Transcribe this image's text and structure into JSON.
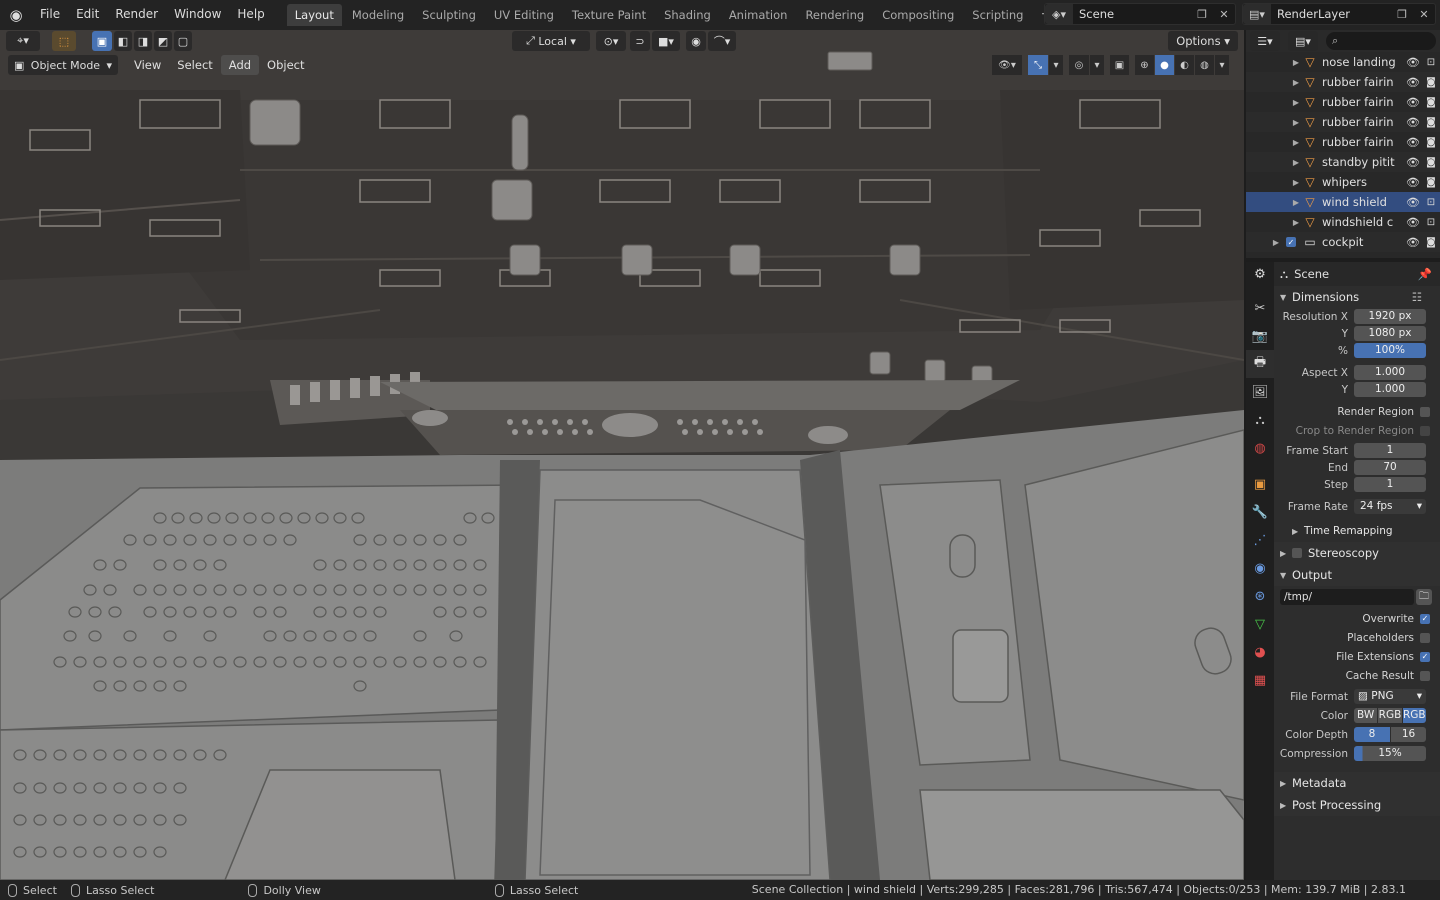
{
  "top_menu": [
    "File",
    "Edit",
    "Render",
    "Window",
    "Help"
  ],
  "workspaces": [
    "Layout",
    "Modeling",
    "Sculpting",
    "UV Editing",
    "Texture Paint",
    "Shading",
    "Animation",
    "Rendering",
    "Compositing",
    "Scripting"
  ],
  "active_workspace": "Layout",
  "scene_name": "Scene",
  "view_layer": "RenderLayer",
  "viewport": {
    "transform_orientation": "Local",
    "options_label": "Options",
    "mode": "Object Mode",
    "menus": [
      "View",
      "Select",
      "Add",
      "Object"
    ]
  },
  "outliner": {
    "rows": [
      {
        "label": "nose landing",
        "selected": false,
        "active_cam": false
      },
      {
        "label": "rubber fairin",
        "selected": false,
        "active_cam": true
      },
      {
        "label": "rubber fairin",
        "selected": false,
        "active_cam": true
      },
      {
        "label": "rubber fairin",
        "selected": false,
        "active_cam": true
      },
      {
        "label": "rubber fairin",
        "selected": false,
        "active_cam": true
      },
      {
        "label": "standby pitit",
        "selected": false,
        "active_cam": true
      },
      {
        "label": "whipers",
        "selected": false,
        "active_cam": true
      },
      {
        "label": "wind shield",
        "selected": true,
        "active_cam": false
      },
      {
        "label": "windshield c",
        "selected": false,
        "active_cam": false
      },
      {
        "label": "cockpit",
        "selected": false,
        "active_cam": true
      }
    ]
  },
  "properties": {
    "context": "Scene",
    "dimensions": {
      "title": "Dimensions",
      "resolution_x_label": "Resolution X",
      "resolution_x": "1920 px",
      "y_label": "Y",
      "resolution_y": "1080 px",
      "percent_label": "%",
      "percent": "100%",
      "aspect_x_label": "Aspect X",
      "aspect_x": "1.000",
      "aspect_y": "1.000",
      "render_region": "Render Region",
      "crop_region": "Crop to Render Region",
      "frame_start_label": "Frame Start",
      "frame_start": "1",
      "end_label": "End",
      "frame_end": "70",
      "step_label": "Step",
      "frame_step": "1",
      "frame_rate_label": "Frame Rate",
      "frame_rate": "24 fps",
      "time_remapping": "Time Remapping"
    },
    "stereoscopy": "Stereoscopy",
    "output": {
      "title": "Output",
      "path": "/tmp/",
      "overwrite": "Overwrite",
      "placeholders": "Placeholders",
      "file_extensions": "File Extensions",
      "cache_result": "Cache Result",
      "file_format_label": "File Format",
      "file_format": "PNG",
      "color_label": "Color",
      "color_options": [
        "BW",
        "RGB",
        "RGB"
      ],
      "color_depth_label": "Color Depth",
      "color_depth": [
        "8",
        "16"
      ],
      "compression_label": "Compression",
      "compression": "15%"
    },
    "metadata": "Metadata",
    "post_processing": "Post Processing"
  },
  "statusbar": {
    "select": "Select",
    "lasso": "Lasso Select",
    "dolly": "Dolly View",
    "lasso2": "Lasso Select",
    "stats": "Scene Collection | wind shield | Verts:299,285 | Faces:281,796 | Tris:567,474 | Objects:0/253 | Mem: 139.7 MiB | 2.83.1"
  },
  "colors": {
    "accent": "#4772b3",
    "mesh_icon": "#ec9a45",
    "viewport_bg": "#3a3836"
  }
}
